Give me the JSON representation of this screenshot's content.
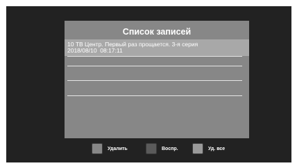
{
  "panel": {
    "title": "Список записей",
    "recordings": [
      {
        "title": "10 ТВ Центр. Первый раз прощается. 3-я серия",
        "datetime": "2018/08/10  08:17:11",
        "selected": true
      }
    ]
  },
  "footer": {
    "buttons": [
      {
        "label": "Удалить",
        "color": "#878787"
      },
      {
        "label": "Воспр.",
        "color": "#5a5a5a"
      },
      {
        "label": "Уд. все",
        "color": "#9a9a9a"
      }
    ]
  }
}
